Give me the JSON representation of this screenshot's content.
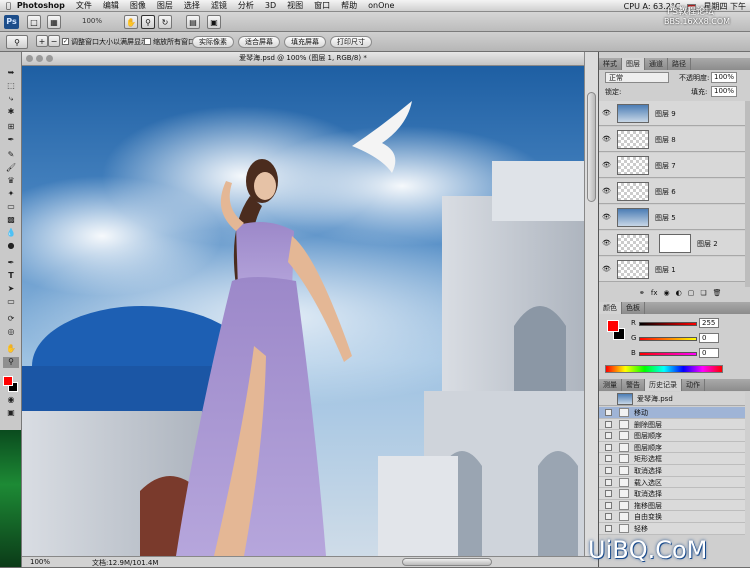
{
  "menubar": {
    "app_name": "Photoshop",
    "items": [
      "文件",
      "编辑",
      "图像",
      "图层",
      "选择",
      "滤镜",
      "分析",
      "3D",
      "视图",
      "窗口",
      "帮助",
      "onOne"
    ],
    "cpu": "CPU A: 63.2°C",
    "right_text": "星期四 下午"
  },
  "optbar": {
    "ps_label": "Ps",
    "zoom": "100%"
  },
  "optbar2": {
    "cb1": "调整窗口大小以满屏显示",
    "cb2": "缩放所有窗口",
    "btn1": "实际像素",
    "btn2": "适合屏幕",
    "btn3": "填充屏幕",
    "btn4": "打印尺寸"
  },
  "document": {
    "tab_title": "爱琴海.psd @ 100% (图层 1, RGB/8) *"
  },
  "statusbar": {
    "zoom": "100%",
    "doc": "文档:12.9M/101.4M"
  },
  "watermark": {
    "top": "PS教程论坛",
    "top2": "BBS.16XX8.COM",
    "bottom": "UiBQ.CoM"
  },
  "layers_panel": {
    "tabs": [
      "样式",
      "图层",
      "通道",
      "路径"
    ],
    "blend_mode": "正常",
    "opacity_label": "不透明度:",
    "opacity": "100%",
    "lock_label": "锁定:",
    "fill_label": "填充:",
    "fill": "100%",
    "layers": [
      {
        "name": "图层 9",
        "thumb": "pic"
      },
      {
        "name": "图层 8",
        "thumb": "trans"
      },
      {
        "name": "图层 7",
        "thumb": "trans"
      },
      {
        "name": "图层 6",
        "thumb": "trans"
      },
      {
        "name": "图层 5",
        "thumb": "pic"
      },
      {
        "name": "图层 2",
        "thumb": "mask"
      },
      {
        "name": "图层 1",
        "thumb": "trans"
      }
    ]
  },
  "color_panel": {
    "tabs": [
      "颜色",
      "色板"
    ],
    "r_label": "R",
    "g_label": "G",
    "b_label": "B",
    "r": "255",
    "g": "0",
    "b": "0"
  },
  "history_panel": {
    "tabs": [
      "测量",
      "警告",
      "历史记录",
      "动作"
    ],
    "file": "爱琴海.psd",
    "items": [
      "移动",
      "删除图层",
      "图层顺序",
      "图层顺序",
      "矩形选框",
      "取消选择",
      "载入选区",
      "取消选择",
      "拖移图层",
      "自由变换",
      "轻移"
    ]
  },
  "colors": {
    "foreground": "#ff0000",
    "accent": "#3b6fb6"
  }
}
